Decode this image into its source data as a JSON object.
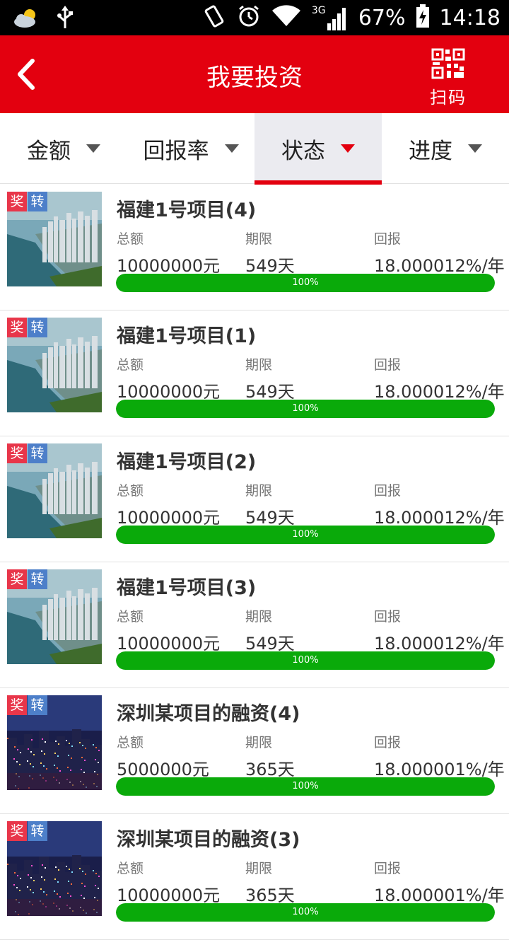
{
  "status_bar": {
    "battery": "67%",
    "time": "14:18",
    "network": "3G",
    "icons": [
      "weather-cloud-icon",
      "usb-icon",
      "rotate-icon",
      "alarm-icon",
      "wifi-icon",
      "signal-icon",
      "battery-charging-icon"
    ]
  },
  "header": {
    "title": "我要投资",
    "scan_label": "扫码",
    "background": "#e3000f"
  },
  "tabs": [
    {
      "label": "金额",
      "active": false
    },
    {
      "label": "回报率",
      "active": false
    },
    {
      "label": "状态",
      "active": true
    },
    {
      "label": "进度",
      "active": false
    }
  ],
  "list_labels": {
    "total": "总额",
    "term": "期限",
    "return": "回报"
  },
  "badges": {
    "jiang": "奖",
    "zhuan": "转"
  },
  "items": [
    {
      "title": "福建1号项目(4)",
      "total": "10000000元",
      "term": "549天",
      "return": "18.000012%/年",
      "progress_text": "100%",
      "progress": 1.0,
      "image": "coastal-city"
    },
    {
      "title": "福建1号项目(1)",
      "total": "10000000元",
      "term": "549天",
      "return": "18.000012%/年",
      "progress_text": "100%",
      "progress": 1.0,
      "image": "coastal-city"
    },
    {
      "title": "福建1号项目(2)",
      "total": "10000000元",
      "term": "549天",
      "return": "18.000012%/年",
      "progress_text": "100%",
      "progress": 1.0,
      "image": "coastal-city"
    },
    {
      "title": "福建1号项目(3)",
      "total": "10000000元",
      "term": "549天",
      "return": "18.000012%/年",
      "progress_text": "100%",
      "progress": 1.0,
      "image": "coastal-city"
    },
    {
      "title": "深圳某项目的融资(4)",
      "total": "5000000元",
      "term": "365天",
      "return": "18.000001%/年",
      "progress_text": "100%",
      "progress": 1.0,
      "image": "night-city"
    },
    {
      "title": "深圳某项目的融资(3)",
      "total": "10000000元",
      "term": "365天",
      "return": "18.000001%/年",
      "progress_text": "100%",
      "progress": 1.0,
      "image": "night-city"
    }
  ]
}
